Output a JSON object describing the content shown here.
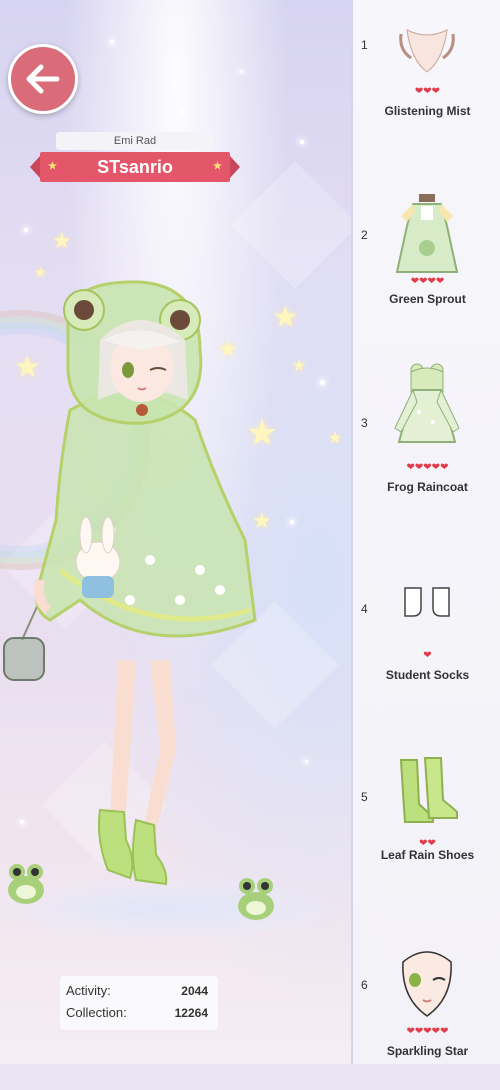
{
  "player": {
    "name": "Emi Rad",
    "title": "STsanrio"
  },
  "stats": {
    "activity_label": "Activity:",
    "activity_value": "2044",
    "collection_label": "Collection:",
    "collection_value": "12264"
  },
  "colors": {
    "accent": "#e4576a",
    "heart": "#e23c4a",
    "back_button": "#d96c78"
  },
  "items": [
    {
      "index": "1",
      "name": "Glistening Mist",
      "hearts": "❤❤❤",
      "rating": 3
    },
    {
      "index": "2",
      "name": "Green Sprout",
      "hearts": "❤❤❤❤",
      "rating": 4
    },
    {
      "index": "3",
      "name": "Frog Raincoat",
      "hearts": "❤❤❤❤❤",
      "rating": 5
    },
    {
      "index": "4",
      "name": "Student Socks",
      "hearts": "❤",
      "rating": 1
    },
    {
      "index": "5",
      "name": "Leaf Rain Shoes",
      "hearts": "❤❤",
      "rating": 2
    },
    {
      "index": "6",
      "name": "Sparkling Star",
      "hearts": "❤❤❤❤❤",
      "rating": 5
    }
  ]
}
